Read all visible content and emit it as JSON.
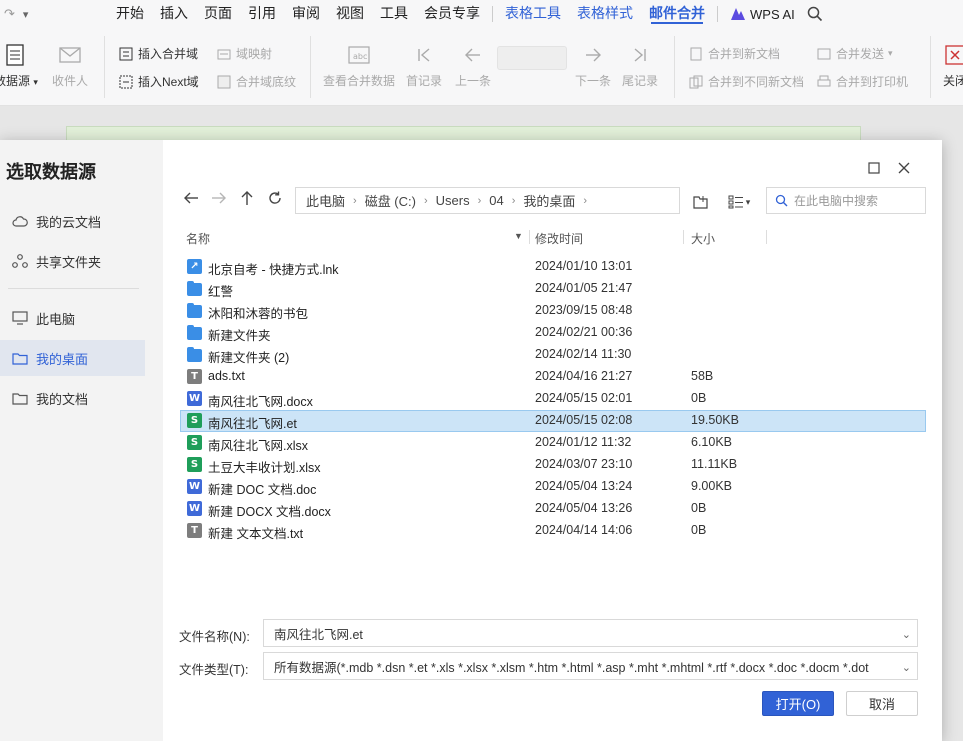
{
  "menubar": {
    "tabs": [
      {
        "label": "开始"
      },
      {
        "label": "插入"
      },
      {
        "label": "页面"
      },
      {
        "label": "引用"
      },
      {
        "label": "审阅"
      },
      {
        "label": "视图"
      },
      {
        "label": "工具"
      },
      {
        "label": "会员专享"
      }
    ],
    "context_tabs": [
      {
        "label": "表格工具"
      },
      {
        "label": "表格样式"
      }
    ],
    "active_tab": "邮件合并",
    "wps_ai": "WPS AI"
  },
  "ribbon": {
    "data_source": "数据源",
    "recipients": "收件人",
    "insert_merge_field": "插入合并域",
    "field_mapping": "域映射",
    "insert_next_field": "插入Next域",
    "merge_field_shading": "合并域底纹",
    "view_merged_data": "查看合并数据",
    "first_record": "首记录",
    "prev_record": "上一条",
    "next_record": "下一条",
    "last_record": "尾记录",
    "merge_to_new_doc": "合并到新文档",
    "merge_to_diff_docs": "合并到不同新文档",
    "merge_send": "合并发送",
    "merge_to_printer": "合并到打印机",
    "close": "关闭"
  },
  "dialog": {
    "title": "选取数据源",
    "sidebar": {
      "cloud_docs": "我的云文档",
      "shared_folder": "共享文件夹",
      "this_pc": "此电脑",
      "my_desktop": "我的桌面",
      "my_documents": "我的文档"
    },
    "breadcrumb": [
      "此电脑",
      "磁盘 (C:)",
      "Users",
      "04",
      "我的桌面"
    ],
    "search_placeholder": "在此电脑中搜索",
    "columns": {
      "name": "名称",
      "modified": "修改时间",
      "size": "大小"
    },
    "files": [
      {
        "name": "北京自考 - 快捷方式.lnk",
        "date": "2024/01/10 13:01",
        "size": "",
        "icon": "shortcut-icon"
      },
      {
        "name": "红警",
        "date": "2024/01/05 21:47",
        "size": "",
        "icon": "folder-icon"
      },
      {
        "name": "沐阳和沐蓉的书包",
        "date": "2023/09/15 08:48",
        "size": "",
        "icon": "folder-icon"
      },
      {
        "name": "新建文件夹",
        "date": "2024/02/21 00:36",
        "size": "",
        "icon": "folder-icon"
      },
      {
        "name": "新建文件夹 (2)",
        "date": "2024/02/14 11:30",
        "size": "",
        "icon": "folder-icon"
      },
      {
        "name": "ads.txt",
        "date": "2024/04/16 21:27",
        "size": "58B",
        "icon": "text-file-icon"
      },
      {
        "name": "南风往北飞网.docx",
        "date": "2024/05/15 02:01",
        "size": "0B",
        "icon": "word-file-icon"
      },
      {
        "name": "南风往北飞网.et",
        "date": "2024/05/15 02:08",
        "size": "19.50KB",
        "icon": "sheet-file-icon",
        "selected": true
      },
      {
        "name": "南风往北飞网.xlsx",
        "date": "2024/01/12 11:32",
        "size": "6.10KB",
        "icon": "sheet-file-icon"
      },
      {
        "name": "土豆大丰收计划.xlsx",
        "date": "2024/03/07 23:10",
        "size": "11.11KB",
        "icon": "sheet-file-icon"
      },
      {
        "name": "新建 DOC 文档.doc",
        "date": "2024/05/04 13:24",
        "size": "9.00KB",
        "icon": "word-file-icon"
      },
      {
        "name": "新建 DOCX 文档.docx",
        "date": "2024/05/04 13:26",
        "size": "0B",
        "icon": "word-file-icon"
      },
      {
        "name": "新建 文本文档.txt",
        "date": "2024/04/14 14:06",
        "size": "0B",
        "icon": "text-file-icon"
      }
    ],
    "filename_label": "文件名称(N):",
    "filename_value": "南风往北飞网.et",
    "filetype_label": "文件类型(T):",
    "filetype_value": "所有数据源(*.mdb *.dsn *.et *.xls *.xlsx *.xlsm *.htm *.html *.asp *.mht *.mhtml *.rtf *.docx *.doc *.docm *.dot",
    "open_button": "打开(O)",
    "cancel_button": "取消"
  },
  "colors": {
    "accent": "#3162d6",
    "selected_row": "#cce4f7",
    "folder": "#3a8ee6",
    "sheet_badge": "#1f9e5a",
    "word_badge": "#3f6ad8",
    "text_badge": "#7d7d7d"
  }
}
